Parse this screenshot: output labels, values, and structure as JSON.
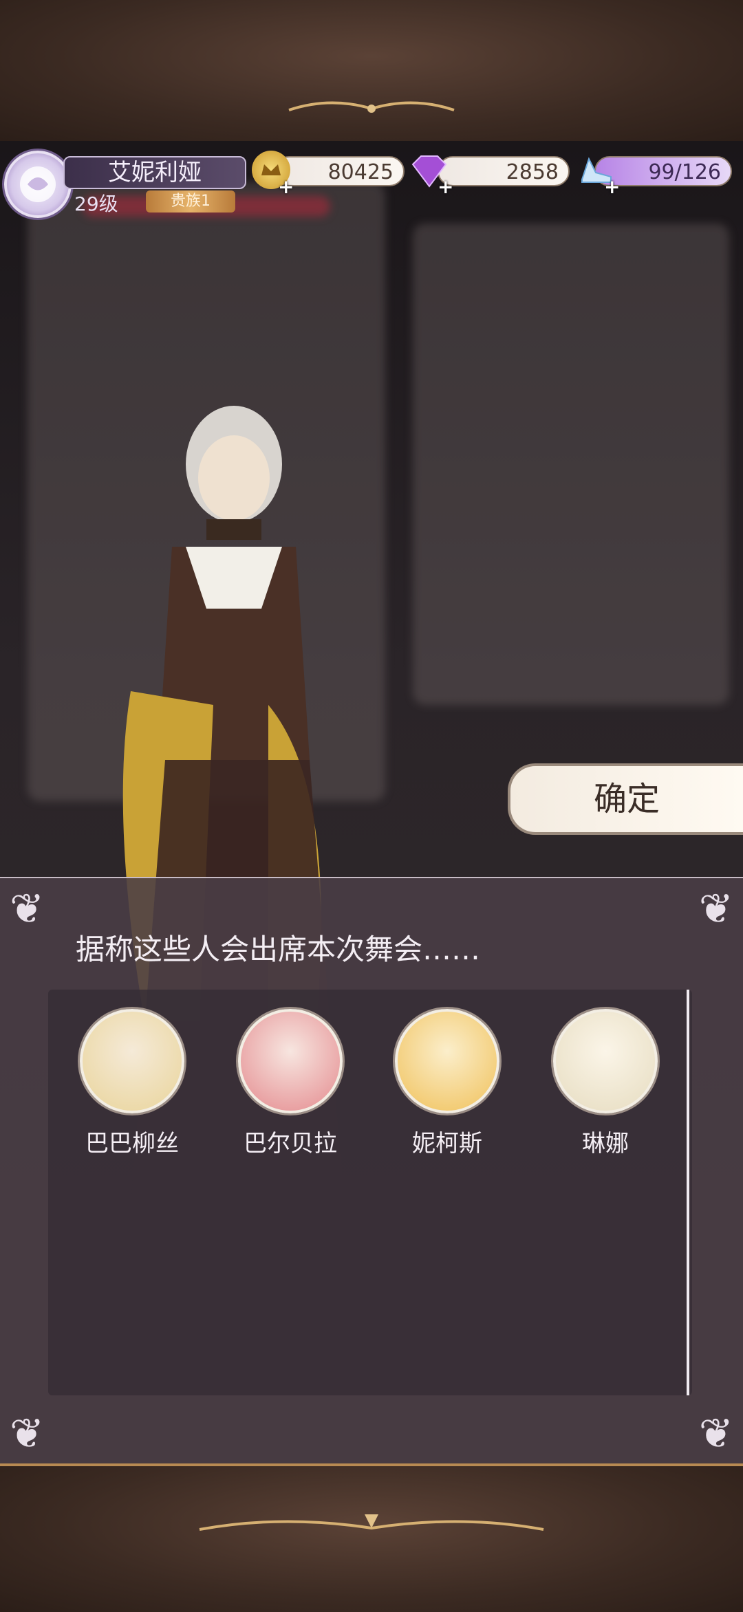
{
  "player": {
    "name": "艾妮利娅",
    "level": "29级",
    "rank": "贵族1"
  },
  "resources": {
    "gold": {
      "value": "80425",
      "icon": "crown-coin-icon"
    },
    "gems": {
      "value": "2858",
      "icon": "purple-diamond-icon"
    },
    "stamina": {
      "value": "99/126",
      "icon": "glass-slipper-icon"
    }
  },
  "confirm_button": "确定",
  "dialog": {
    "text": "据称这些人会出席本次舞会……",
    "members": [
      {
        "name": "巴巴柳丝",
        "color": "#e9d49a"
      },
      {
        "name": "巴尔贝拉",
        "color": "#e48a8e"
      },
      {
        "name": "妮柯斯",
        "color": "#f0c15a"
      },
      {
        "name": "琳娜",
        "color": "#e6dcc0"
      }
    ]
  }
}
